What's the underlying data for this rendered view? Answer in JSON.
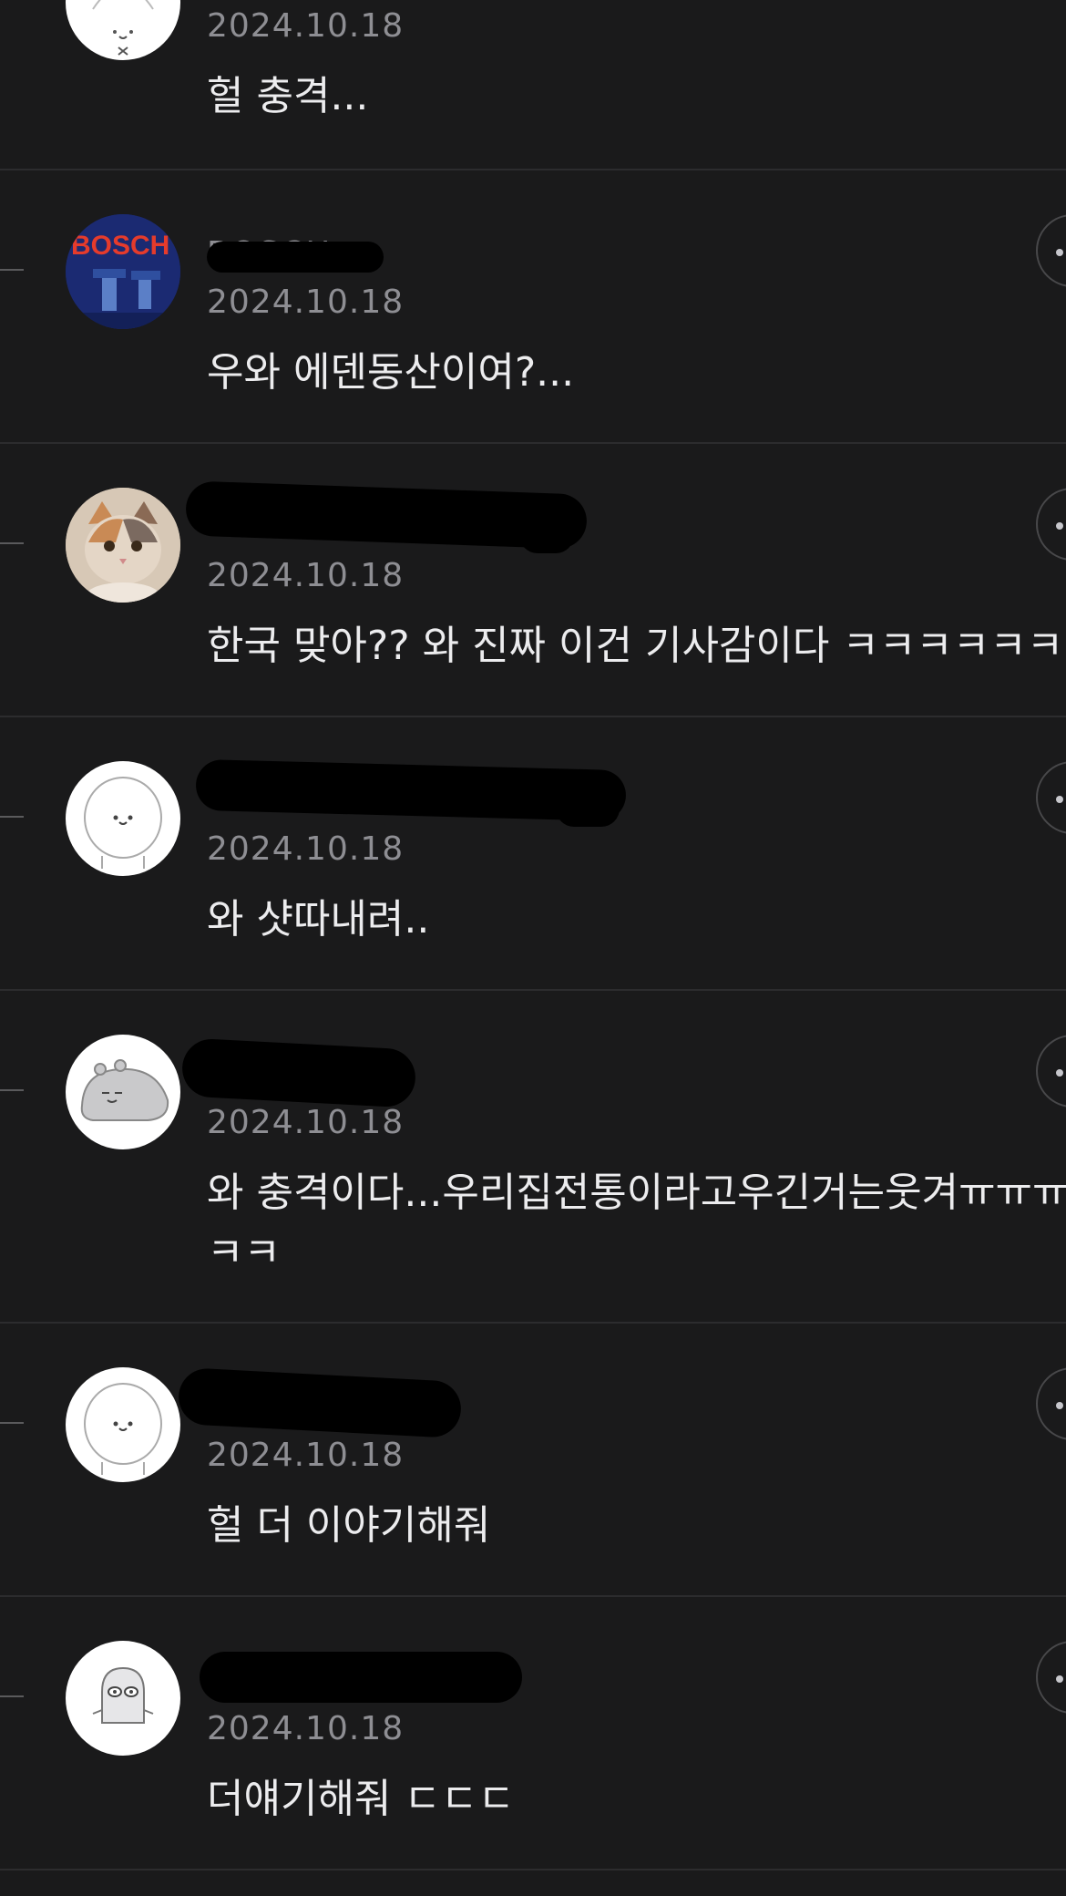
{
  "comments": [
    {
      "avatar": "smiling-bear-x-icon",
      "name": "",
      "date": "2024.10.18",
      "text": "헐 충격..."
    },
    {
      "avatar": "bosch-avatar",
      "name": "BOSCH",
      "date": "2024.10.18",
      "text": "우와 에덴동산이여?..."
    },
    {
      "avatar": "cat-avatar",
      "name": "",
      "date": "2024.10.18",
      "text": "한국 맞아?? 와 진짜 이건 기사감이다 ㅋㅋㅋㅋㅋㅋ"
    },
    {
      "avatar": "smiling-bear-icon",
      "name": "",
      "date": "2024.10.18",
      "text": "와 샷따내려.."
    },
    {
      "avatar": "grey-creature-icon",
      "name": "",
      "date": "2024.10.18",
      "text": "와 충격이다...우리집전통이라고우긴거는웃겨ㅠㅠㅠ",
      "text2": "ㅋㅋ"
    },
    {
      "avatar": "smiling-bear-icon",
      "name": "",
      "date": "2024.10.18",
      "text": "헐 더 이야기해줘"
    },
    {
      "avatar": "ghost-creature-icon",
      "name": "",
      "date": "2024.10.18",
      "text": "더얘기해줘 ㄷㄷㄷ"
    }
  ],
  "bosch_logo_text": "BOSCH"
}
